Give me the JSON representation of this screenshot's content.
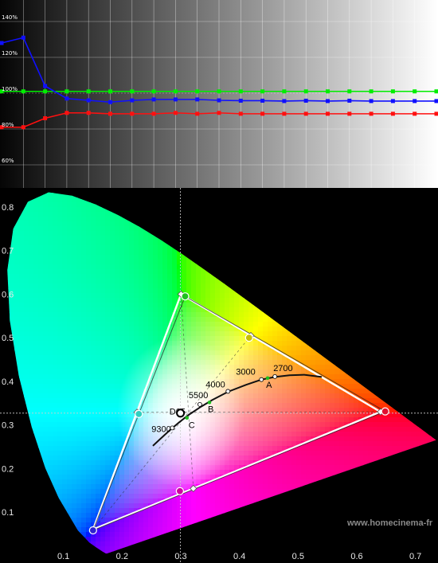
{
  "chart_data": [
    {
      "type": "line",
      "grid": true,
      "ylim": [
        55,
        150
      ],
      "y_tick_labels": [
        "140%",
        "120%",
        "100%",
        "80%",
        "60%"
      ],
      "y_tick_values": [
        140,
        120,
        100,
        80,
        60
      ],
      "x": [
        0,
        5,
        10,
        15,
        20,
        25,
        30,
        35,
        40,
        45,
        50,
        55,
        60,
        65,
        70,
        75,
        80,
        85,
        90,
        95,
        100
      ],
      "series": [
        {
          "color": "#00ee00",
          "values": [
            101,
            101,
            101,
            101,
            101,
            101,
            101,
            101,
            101,
            101,
            101,
            101,
            101,
            101,
            101,
            101,
            101,
            101,
            101,
            101,
            101
          ]
        },
        {
          "color": "#1010ff",
          "values": [
            128,
            131,
            104,
            97,
            96,
            95,
            96,
            96.5,
            96.5,
            96.5,
            96,
            95.8,
            95.8,
            95.6,
            95.8,
            95.6,
            95.8,
            95.6,
            95.6,
            95.6,
            95.6
          ]
        },
        {
          "color": "#ff1010",
          "values": [
            81,
            81,
            86,
            89,
            89,
            88.5,
            88.5,
            88.5,
            89,
            88.5,
            89,
            88.5,
            88.5,
            88.5,
            88.5,
            88.5,
            88.5,
            88.5,
            88.5,
            88.5,
            88.5
          ]
        }
      ]
    },
    {
      "type": "scatter",
      "xlim": [
        0.0,
        0.75
      ],
      "ylim": [
        0.0,
        0.85
      ],
      "x_tick_labels": [
        "0.1",
        "0.2",
        "0.3",
        "0.4",
        "0.5",
        "0.6",
        "0.7"
      ],
      "x_tick_values": [
        0.1,
        0.2,
        0.3,
        0.4,
        0.5,
        0.6,
        0.7
      ],
      "y_tick_labels": [
        "0.1",
        "0.2",
        "0.3",
        "0.4",
        "0.5",
        "0.6",
        "0.7",
        "0.8"
      ],
      "y_tick_values": [
        0.1,
        0.2,
        0.3,
        0.4,
        0.5,
        0.6,
        0.7,
        0.8
      ],
      "reference_gamut": [
        [
          0.64,
          0.33
        ],
        [
          0.3,
          0.6
        ],
        [
          0.15,
          0.06
        ]
      ],
      "measured_gamut": [
        [
          0.648,
          0.331
        ],
        [
          0.307,
          0.595
        ],
        [
          0.15,
          0.058
        ]
      ],
      "reference_secondaries": [
        [
          0.225,
          0.329
        ],
        [
          0.321,
          0.154
        ],
        [
          0.419,
          0.505
        ]
      ],
      "measured_white": [
        0.299,
        0.327
      ],
      "d65": [
        0.3127,
        0.329
      ],
      "cct_labels": [
        {
          "text": "2700",
          "x": 0.46,
          "y": 0.411
        },
        {
          "text": "3000",
          "x": 0.437,
          "y": 0.404
        },
        {
          "text": "4000",
          "x": 0.38,
          "y": 0.377
        },
        {
          "text": "5500",
          "x": 0.332,
          "y": 0.347
        },
        {
          "text": "9300",
          "x": 0.285,
          "y": 0.293
        },
        {
          "text": "D65",
          "x": 0.3127,
          "y": 0.329
        },
        {
          "text": "A",
          "x": 0.4476,
          "y": 0.4074
        },
        {
          "text": "B",
          "x": 0.3484,
          "y": 0.3516
        },
        {
          "text": "C",
          "x": 0.3101,
          "y": 0.3162
        }
      ],
      "planckian_locus": [
        [
          0.252,
          0.252
        ],
        [
          0.264,
          0.267
        ],
        [
          0.281,
          0.288
        ],
        [
          0.296,
          0.305
        ],
        [
          0.313,
          0.323
        ],
        [
          0.332,
          0.34
        ],
        [
          0.353,
          0.357
        ],
        [
          0.38,
          0.376
        ],
        [
          0.411,
          0.392
        ],
        [
          0.437,
          0.404
        ],
        [
          0.46,
          0.41
        ],
        [
          0.485,
          0.414
        ],
        [
          0.51,
          0.415
        ],
        [
          0.54,
          0.41
        ]
      ],
      "watermark": "www.homecinema-fr"
    }
  ]
}
